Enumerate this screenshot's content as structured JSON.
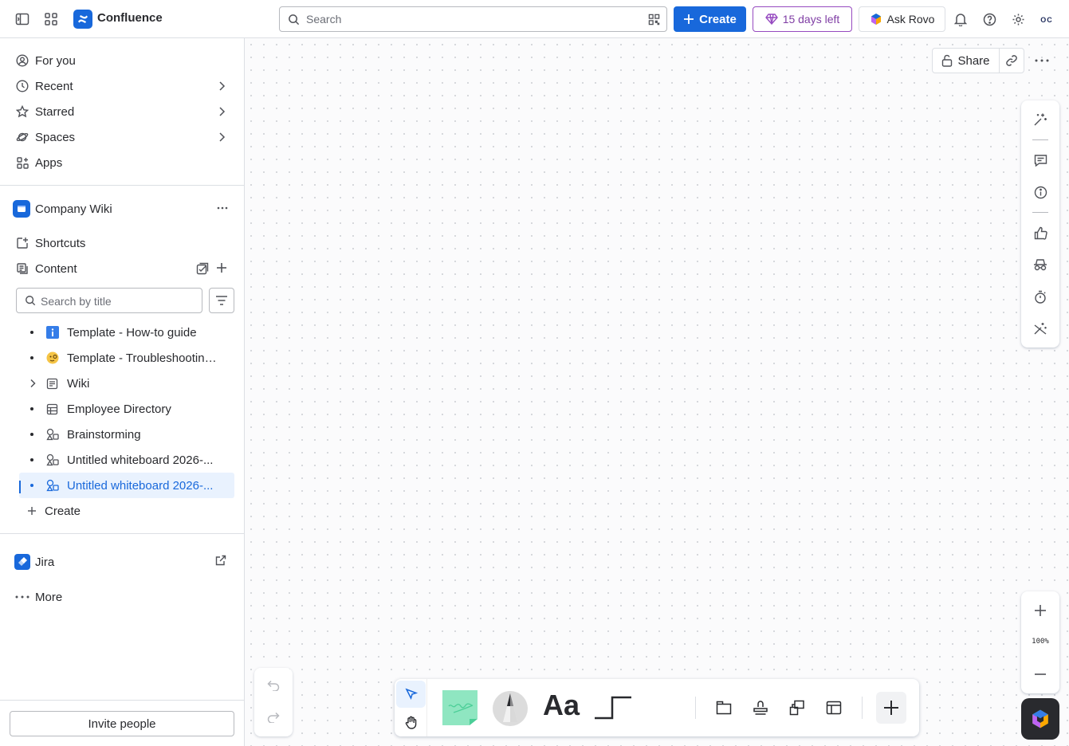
{
  "header": {
    "app_name": "Confluence",
    "search_placeholder": "Search",
    "create_label": "Create",
    "trial_label": "15 days left",
    "rovo_label": "Ask Rovo",
    "avatar_initials": "OC",
    "brand_color": "#1868db"
  },
  "sidebar": {
    "nav": [
      {
        "label": "For you",
        "icon": "user-circle-icon"
      },
      {
        "label": "Recent",
        "icon": "clock-icon"
      },
      {
        "label": "Starred",
        "icon": "star-icon"
      },
      {
        "label": "Spaces",
        "icon": "planet-icon"
      },
      {
        "label": "Apps",
        "icon": "apps-icon"
      }
    ],
    "space_name": "Company Wiki",
    "shortcuts_label": "Shortcuts",
    "content_label": "Content",
    "search_placeholder": "Search by title",
    "tree": [
      {
        "label": "Template - How-to guide",
        "icon": "info-icon"
      },
      {
        "label": "Template - Troubleshooting article",
        "icon": "face-emoji-icon"
      },
      {
        "label": "Wiki",
        "icon": "page-icon"
      },
      {
        "label": "Employee Directory",
        "icon": "table-icon"
      },
      {
        "label": "Brainstorming",
        "icon": "whiteboard-icon"
      },
      {
        "label": "Untitled whiteboard 2026-...",
        "icon": "whiteboard-icon"
      },
      {
        "label": "Untitled whiteboard 2026-...",
        "icon": "whiteboard-icon",
        "selected": true
      }
    ],
    "create_label": "Create",
    "jira_label": "Jira",
    "more_label": "More",
    "invite_label": "Invite people"
  },
  "canvas": {
    "share_label": "Share",
    "zoom_level": "100%"
  }
}
